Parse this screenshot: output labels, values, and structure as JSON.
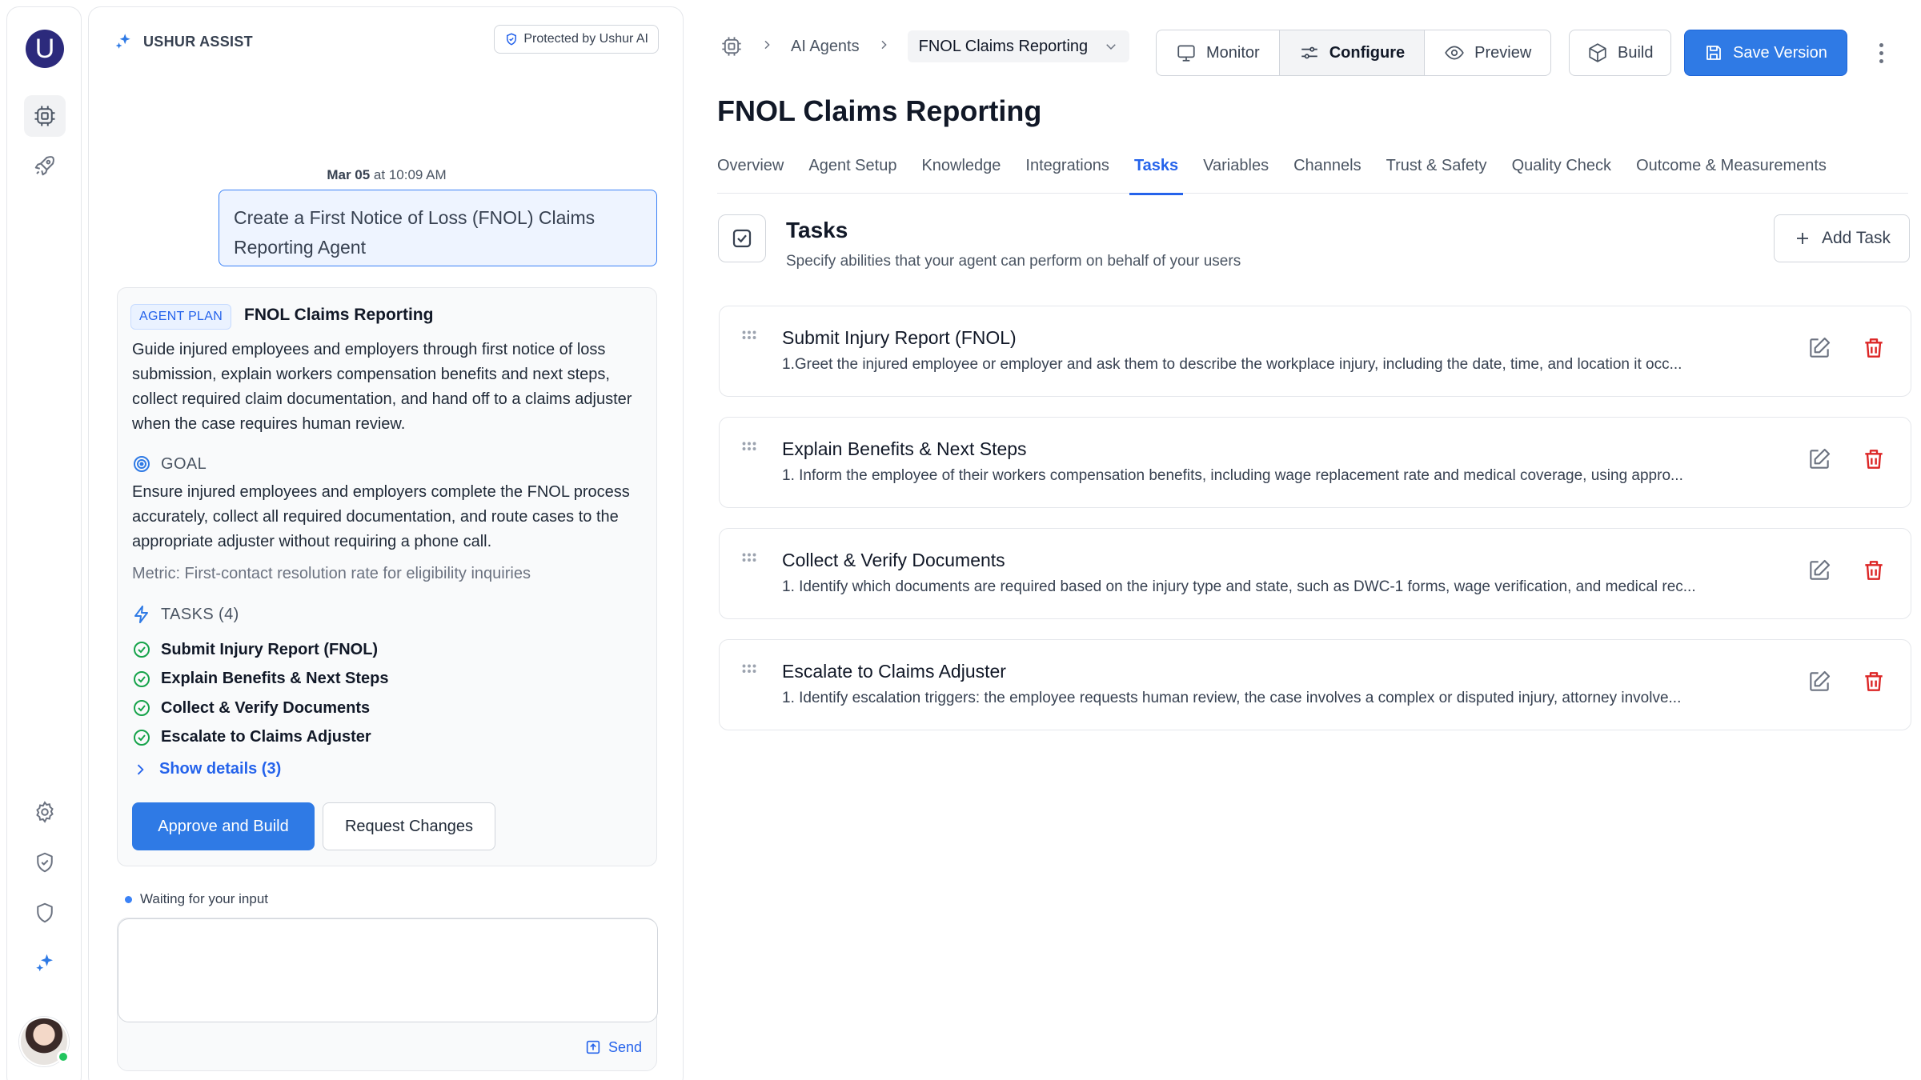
{
  "rail": {
    "logo_letter": "U",
    "items": [
      {
        "name": "agents-icon",
        "active": true
      },
      {
        "name": "rocket-icon",
        "active": false
      },
      {
        "name": "gear-icon",
        "active": false
      },
      {
        "name": "shield-check-icon",
        "active": false
      },
      {
        "name": "shield-icon",
        "active": false
      },
      {
        "name": "sparkle-icon",
        "active": false
      }
    ],
    "colors": {
      "logo": "#2c2a7c",
      "online": "#22c55e"
    }
  },
  "assist": {
    "title": "USHUR ASSIST",
    "protected_label": "Protected by Ushur AI",
    "message_date": "Mar 05",
    "message_at": " at 10:09 AM",
    "user_message": "Create a First Notice of Loss (FNOL) Claims Reporting Agent",
    "plan": {
      "badge": "AGENT PLAN",
      "name": "FNOL Claims Reporting",
      "description": "Guide injured employees and employers through first notice of loss submission, explain workers compensation benefits and next steps, collect required claim documentation, and hand off to a claims adjuster when the case requires human review.",
      "goal_label": "GOAL",
      "goal_text": "Ensure injured employees and employers complete the FNOL process accurately, collect all required documentation, and route cases to the appropriate adjuster without requiring a phone call.",
      "metric": "Metric: First-contact resolution rate for eligibility inquiries",
      "tasks_label": "TASKS (4)",
      "tasks": [
        "Submit Injury Report (FNOL)",
        "Explain Benefits & Next Steps",
        "Collect & Verify Documents",
        "Escalate to Claims Adjuster"
      ],
      "show_details": "Show details (3)",
      "approve_label": "Approve and Build",
      "request_label": "Request Changes"
    },
    "waiting": "Waiting for your input",
    "input_value": "",
    "send_label": "Send"
  },
  "header": {
    "breadcrumb": [
      "AI Agents",
      "FNOL Claims Reporting"
    ],
    "modes": [
      "Monitor",
      "Configure",
      "Preview"
    ],
    "active_mode": "Configure",
    "build_label": "Build",
    "save_label": "Save Version",
    "accent": "#2f7ae5"
  },
  "page": {
    "title": "FNOL Claims Reporting",
    "tabs": [
      "Overview",
      "Agent Setup",
      "Knowledge",
      "Integrations",
      "Tasks",
      "Variables",
      "Channels",
      "Trust & Safety",
      "Quality Check",
      "Outcome & Measurements"
    ],
    "active_tab": "Tasks"
  },
  "tasks": {
    "title": "Tasks",
    "subtitle": "Specify abilities that your agent can perform on behalf of your users",
    "add_label": "Add Task",
    "items": [
      {
        "title": "Submit Injury Report (FNOL)",
        "desc": "1.Greet the injured employee or employer and ask them to describe the workplace injury, including the date, time, and location it occ..."
      },
      {
        "title": "Explain Benefits & Next Steps",
        "desc": "1. Inform the employee of their workers compensation benefits, including wage replacement rate and medical coverage, using appro..."
      },
      {
        "title": "Collect & Verify Documents",
        "desc": "1. Identify which documents are required based on the injury type and state, such as DWC-1 forms, wage verification, and medical rec..."
      },
      {
        "title": "Escalate to Claims Adjuster",
        "desc": "1. Identify escalation triggers: the employee requests human review, the case involves a complex or disputed injury, attorney involve..."
      }
    ],
    "delete_color": "#dc2626"
  }
}
